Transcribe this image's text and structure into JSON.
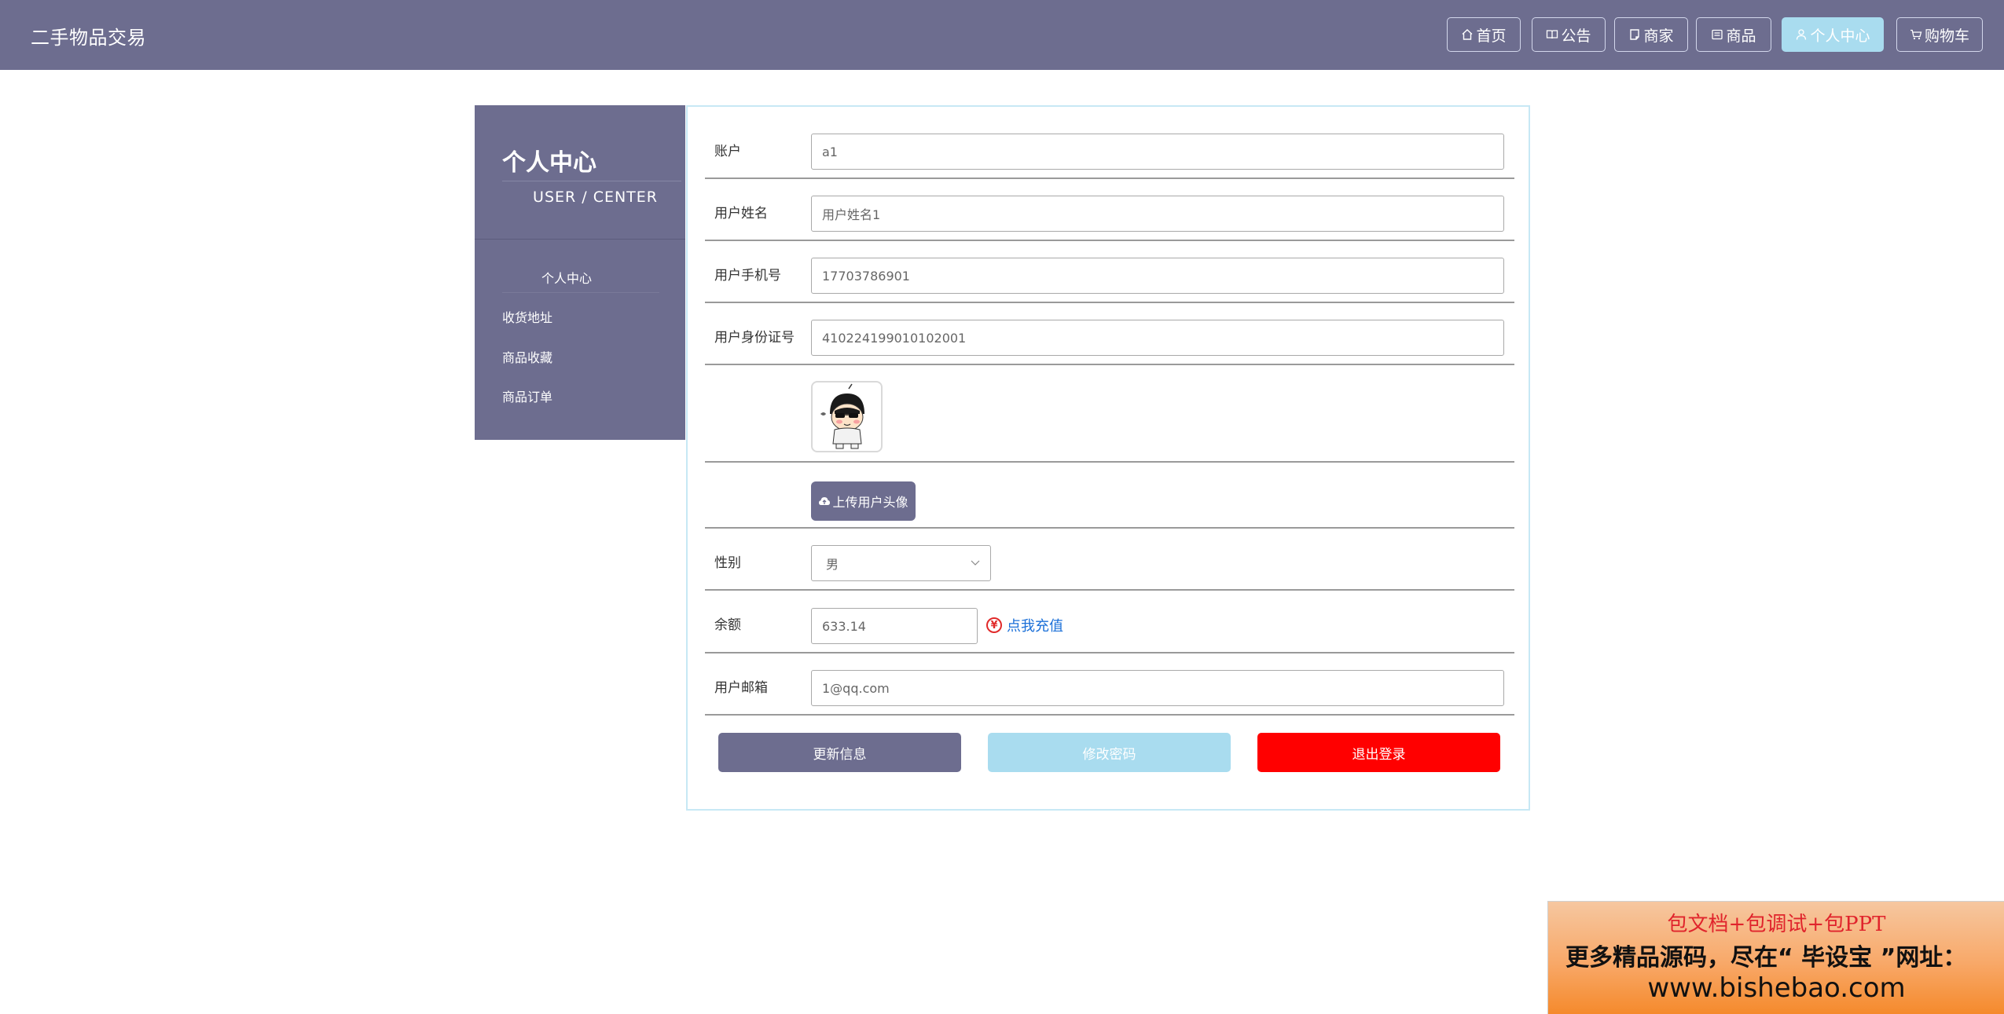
{
  "header": {
    "brand": "二手物品交易",
    "nav": [
      {
        "label": "首页",
        "icon": "home-icon"
      },
      {
        "label": "公告",
        "icon": "book-icon"
      },
      {
        "label": "商家",
        "icon": "shop-icon"
      },
      {
        "label": "商品",
        "icon": "goods-icon"
      },
      {
        "label": "个人中心",
        "icon": "user-icon",
        "active": true
      },
      {
        "label": "购物车",
        "icon": "cart-icon"
      }
    ]
  },
  "sidebar": {
    "title": "个人中心",
    "subtitle": "USER / CENTER",
    "items": [
      {
        "label": "个人中心",
        "active": true
      },
      {
        "label": "收货地址"
      },
      {
        "label": "商品收藏"
      },
      {
        "label": "商品订单"
      }
    ]
  },
  "form": {
    "account": {
      "label": "账户",
      "value": "a1"
    },
    "name": {
      "label": "用户姓名",
      "value": "用户姓名1"
    },
    "phone": {
      "label": "用户手机号",
      "value": "17703786901"
    },
    "id_card": {
      "label": "用户身份证号",
      "value": "410224199010102001"
    },
    "upload_label": "上传用户头像",
    "gender": {
      "label": "性别",
      "value": "男"
    },
    "balance": {
      "label": "余额",
      "value": "633.14",
      "recharge_label": "点我充值"
    },
    "email": {
      "label": "用户邮箱",
      "value": "1@qq.com"
    }
  },
  "actions": {
    "update": "更新信息",
    "change_password": "修改密码",
    "logout": "退出登录"
  },
  "ad": {
    "line1": "包文档+包调试+包PPT",
    "line2": "更多精品源码，尽在“ 毕设宝 ”网址：",
    "line3": "www.bishebao.com"
  },
  "colors": {
    "primary": "#6d6d8f",
    "active_nav": "#a9dcef",
    "logout": "#ff0000",
    "link": "#1a6fd8"
  }
}
